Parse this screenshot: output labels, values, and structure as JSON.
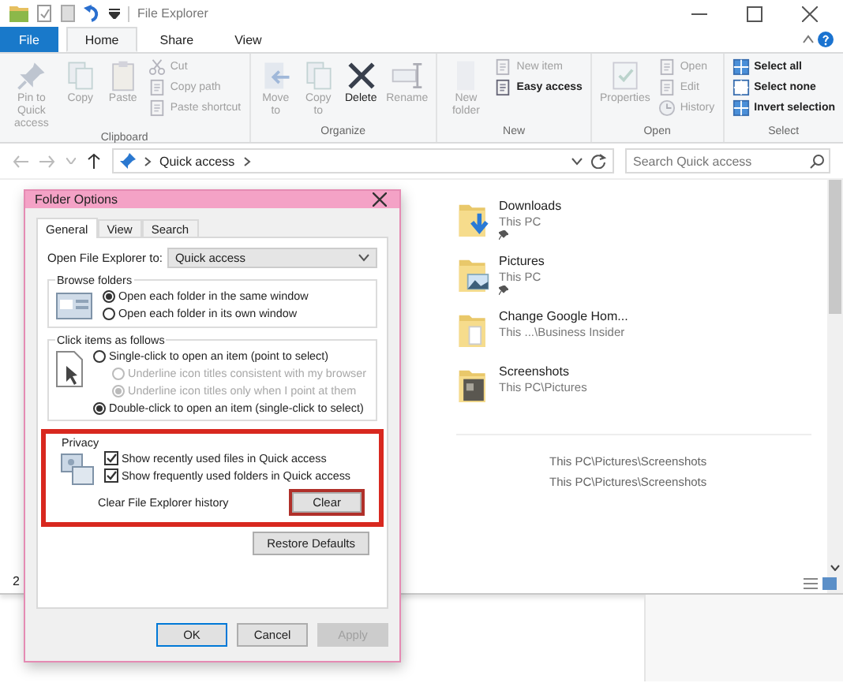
{
  "window": {
    "title": "File Explorer"
  },
  "ribbon_tabs": [
    {
      "label": "File",
      "kind": "file",
      "selected": false
    },
    {
      "label": "Home",
      "kind": "tab",
      "selected": true
    },
    {
      "label": "Share",
      "kind": "tab",
      "selected": false
    },
    {
      "label": "View",
      "kind": "tab",
      "selected": false
    }
  ],
  "ribbon_groups": [
    {
      "label": "Clipboard",
      "large": [
        {
          "label": "Pin to Quick access",
          "disabled": true
        },
        {
          "label": "Copy",
          "disabled": true
        },
        {
          "label": "Paste",
          "disabled": true
        }
      ],
      "small": [
        {
          "label": "Cut",
          "disabled": true
        },
        {
          "label": "Copy path",
          "disabled": true
        },
        {
          "label": "Paste shortcut",
          "disabled": true
        }
      ]
    },
    {
      "label": "Organize",
      "large": [
        {
          "label": "Move to",
          "disabled": true
        },
        {
          "label": "Copy to",
          "disabled": true
        },
        {
          "label": "Delete",
          "disabled": false
        },
        {
          "label": "Rename",
          "disabled": true
        }
      ]
    },
    {
      "label": "New",
      "large": [
        {
          "label": "New folder",
          "disabled": true
        }
      ],
      "small": [
        {
          "label": "New item",
          "disabled": true
        },
        {
          "label": "Easy access",
          "disabled": false
        }
      ]
    },
    {
      "label": "Open",
      "large": [
        {
          "label": "Properties",
          "disabled": true
        }
      ],
      "small": [
        {
          "label": "Open",
          "disabled": true
        },
        {
          "label": "Edit",
          "disabled": true
        },
        {
          "label": "History",
          "disabled": true
        }
      ]
    },
    {
      "label": "Select",
      "small": [
        {
          "label": "Select all",
          "disabled": false
        },
        {
          "label": "Select none",
          "disabled": false
        },
        {
          "label": "Invert selection",
          "disabled": false
        }
      ]
    }
  ],
  "address_bar": {
    "path": "Quick access",
    "search_placeholder": "Search Quick access"
  },
  "frequent_folders": [
    {
      "name": "Downloads",
      "location": "This PC",
      "kind": "downloads",
      "pinned": true
    },
    {
      "name": "Pictures",
      "location": "This PC",
      "kind": "pictures",
      "pinned": true
    },
    {
      "name": "Change Google Hom...",
      "location": "This ...\\Business Insider",
      "kind": "documents",
      "pinned": false
    },
    {
      "name": "Screenshots",
      "location": "This PC\\Pictures",
      "kind": "screenshots",
      "pinned": false
    }
  ],
  "recent_files": [
    {
      "location": "This PC\\Pictures\\Screenshots"
    },
    {
      "location": "This PC\\Pictures\\Screenshots"
    }
  ],
  "status_bar": "2",
  "dialog": {
    "title": "Folder Options",
    "tabs": [
      {
        "label": "General",
        "selected": true
      },
      {
        "label": "View",
        "selected": false
      },
      {
        "label": "Search",
        "selected": false
      }
    ],
    "open_to": {
      "label": "Open File Explorer to:",
      "value": "Quick access"
    },
    "browse_folders": {
      "title": "Browse folders",
      "options": [
        {
          "label": "Open each folder in the same window",
          "selected": true
        },
        {
          "label": "Open each folder in its own window",
          "selected": false
        }
      ]
    },
    "click_items": {
      "title": "Click items as follows",
      "options": [
        {
          "label": "Single-click to open an item (point to select)",
          "selected": false,
          "disabled": false,
          "children": [
            {
              "label": "Underline icon titles consistent with my browser",
              "selected": false,
              "disabled": true
            },
            {
              "label": "Underline icon titles only when I point at them",
              "selected": true,
              "disabled": true
            }
          ]
        },
        {
          "label": "Double-click to open an item (single-click to select)",
          "selected": true,
          "disabled": false
        }
      ]
    },
    "privacy": {
      "title": "Privacy",
      "highlighted": true,
      "checkboxes": [
        {
          "label": "Show recently used files in Quick access",
          "checked": true
        },
        {
          "label": "Show frequently used folders in Quick access",
          "checked": true
        }
      ],
      "clear_label": "Clear File Explorer history",
      "clear_button": {
        "label": "Clear",
        "highlighted": true
      }
    },
    "restore_button": "Restore Defaults",
    "buttons": [
      {
        "label": "OK",
        "kind": "default",
        "disabled": false
      },
      {
        "label": "Cancel",
        "kind": "normal",
        "disabled": false
      },
      {
        "label": "Apply",
        "kind": "normal",
        "disabled": true
      }
    ]
  }
}
